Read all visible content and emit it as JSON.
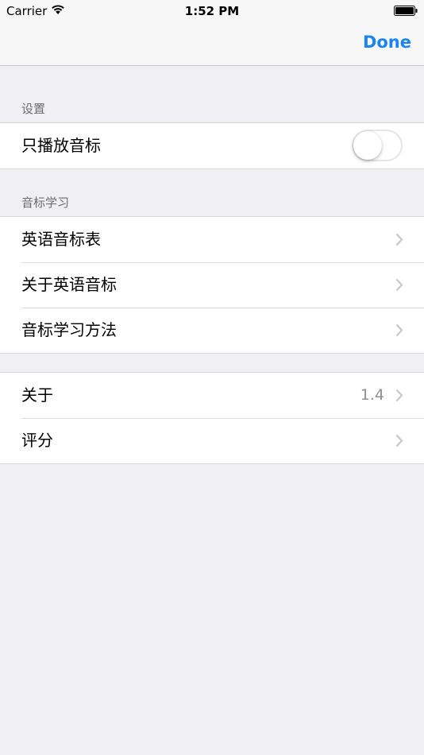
{
  "status_bar": {
    "carrier": "Carrier",
    "time": "1:52 PM"
  },
  "nav": {
    "done_label": "Done"
  },
  "sections": {
    "settings": {
      "header": "设置",
      "items": [
        {
          "label": "只播放音标",
          "toggle_on": false
        }
      ]
    },
    "learning": {
      "header": "音标学习",
      "items": [
        {
          "label": "英语音标表"
        },
        {
          "label": "关于英语音标"
        },
        {
          "label": "音标学习方法"
        }
      ]
    },
    "about": {
      "items": [
        {
          "label": "关于",
          "value": "1.4"
        },
        {
          "label": "评分"
        }
      ]
    }
  },
  "colors": {
    "accent": "#1a84f0",
    "background": "#efeff4",
    "secondary_text": "#8e8e93"
  }
}
